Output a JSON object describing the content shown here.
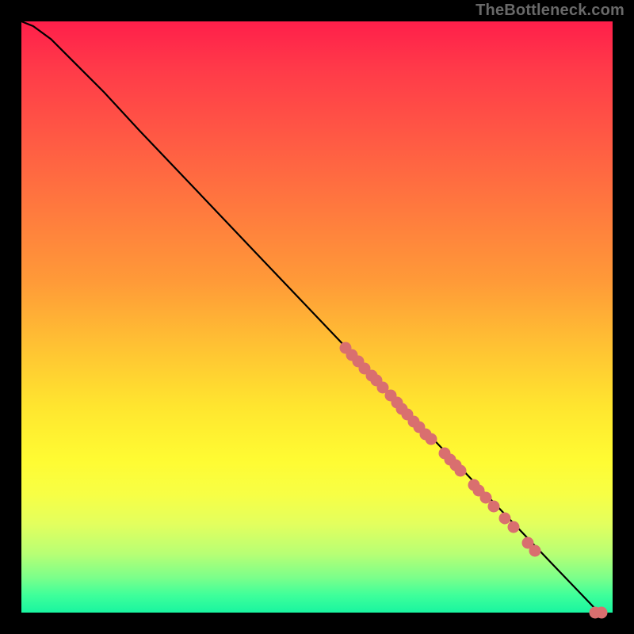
{
  "attribution": "TheBottleneck.com",
  "chart_data": {
    "type": "line",
    "title": "",
    "xlabel": "",
    "ylabel": "",
    "xlim": [
      0,
      100
    ],
    "ylim": [
      0,
      100
    ],
    "grid": false,
    "legend": null,
    "background": "rainbow-vertical",
    "curve": [
      {
        "x": 0.0,
        "y": 100.0
      },
      {
        "x": 2.0,
        "y": 99.2
      },
      {
        "x": 5.0,
        "y": 97.0
      },
      {
        "x": 9.0,
        "y": 93.0
      },
      {
        "x": 14.0,
        "y": 88.0
      },
      {
        "x": 20.0,
        "y": 81.5
      },
      {
        "x": 30.0,
        "y": 71.0
      },
      {
        "x": 40.0,
        "y": 60.5
      },
      {
        "x": 50.0,
        "y": 50.0
      },
      {
        "x": 60.0,
        "y": 39.5
      },
      {
        "x": 70.0,
        "y": 29.0
      },
      {
        "x": 80.0,
        "y": 18.5
      },
      {
        "x": 90.0,
        "y": 8.0
      },
      {
        "x": 97.7,
        "y": 0.0
      }
    ],
    "points": [
      {
        "x": 54.8,
        "y": 44.8
      },
      {
        "x": 55.9,
        "y": 43.6
      },
      {
        "x": 57.0,
        "y": 42.5
      },
      {
        "x": 58.1,
        "y": 41.3
      },
      {
        "x": 59.2,
        "y": 40.1
      },
      {
        "x": 60.0,
        "y": 39.3
      },
      {
        "x": 61.1,
        "y": 38.1
      },
      {
        "x": 62.4,
        "y": 36.7
      },
      {
        "x": 63.5,
        "y": 35.5
      },
      {
        "x": 64.4,
        "y": 34.5
      },
      {
        "x": 65.3,
        "y": 33.5
      },
      {
        "x": 66.4,
        "y": 32.3
      },
      {
        "x": 67.3,
        "y": 31.4
      },
      {
        "x": 68.4,
        "y": 30.2
      },
      {
        "x": 69.3,
        "y": 29.3
      },
      {
        "x": 71.6,
        "y": 26.9
      },
      {
        "x": 72.5,
        "y": 25.9
      },
      {
        "x": 73.4,
        "y": 24.9
      },
      {
        "x": 74.3,
        "y": 24.0
      },
      {
        "x": 76.5,
        "y": 21.6
      },
      {
        "x": 77.4,
        "y": 20.6
      },
      {
        "x": 78.5,
        "y": 19.5
      },
      {
        "x": 79.9,
        "y": 18.0
      },
      {
        "x": 81.8,
        "y": 16.0
      },
      {
        "x": 83.2,
        "y": 14.5
      },
      {
        "x": 85.7,
        "y": 11.8
      },
      {
        "x": 86.9,
        "y": 10.5
      },
      {
        "x": 97.0,
        "y": 0.0
      },
      {
        "x": 98.1,
        "y": 0.0
      }
    ]
  },
  "colors": {
    "dot": "#d96f6f",
    "curve": "#000000",
    "attribution": "#696969"
  }
}
